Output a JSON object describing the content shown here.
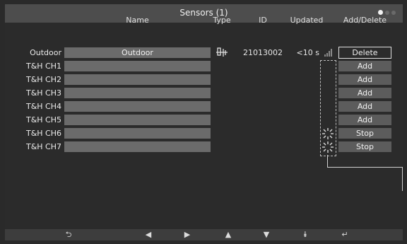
{
  "window": {
    "title": "Sensors (1)"
  },
  "pager": {
    "dots": 3,
    "active": 0
  },
  "table": {
    "headers": {
      "name": "Name",
      "type": "Type",
      "id": "ID",
      "updated": "Updated",
      "action": "Add/Delete"
    },
    "rows": [
      {
        "label": "Outdoor",
        "name": "Outdoor",
        "id": "21013002",
        "updated": "<10 s",
        "action": "Delete",
        "has_type_icon": true
      },
      {
        "label": "T&H CH1",
        "name": "",
        "id": "",
        "updated": "",
        "action": "Add"
      },
      {
        "label": "T&H CH2",
        "name": "",
        "id": "",
        "updated": "",
        "action": "Add"
      },
      {
        "label": "T&H CH3",
        "name": "",
        "id": "",
        "updated": "",
        "action": "Add"
      },
      {
        "label": "T&H CH4",
        "name": "",
        "id": "",
        "updated": "",
        "action": "Add"
      },
      {
        "label": "T&H CH5",
        "name": "",
        "id": "",
        "updated": "",
        "action": "Add"
      },
      {
        "label": "T&H CH6",
        "name": "",
        "id": "",
        "updated": "",
        "action": "Stop",
        "searching": true
      },
      {
        "label": "T&H CH7",
        "name": "",
        "id": "",
        "updated": "",
        "action": "Stop",
        "searching": true
      }
    ]
  },
  "navbar": {
    "buttons": [
      {
        "name": "back-icon",
        "glyph": "⮌"
      },
      {
        "name": "left-arrow-icon",
        "glyph": "◀"
      },
      {
        "name": "right-arrow-icon",
        "glyph": "▶"
      },
      {
        "name": "up-arrow-icon",
        "glyph": "▲"
      },
      {
        "name": "down-arrow-icon",
        "glyph": "▼"
      },
      {
        "name": "page-down-icon",
        "glyph": "⯯"
      },
      {
        "name": "enter-icon",
        "glyph": "↵"
      }
    ]
  },
  "colors": {
    "background": "#2b2b2b",
    "titlebar": "#4d4d4d",
    "field": "#6b6b6b",
    "button": "#5c5c5c"
  }
}
